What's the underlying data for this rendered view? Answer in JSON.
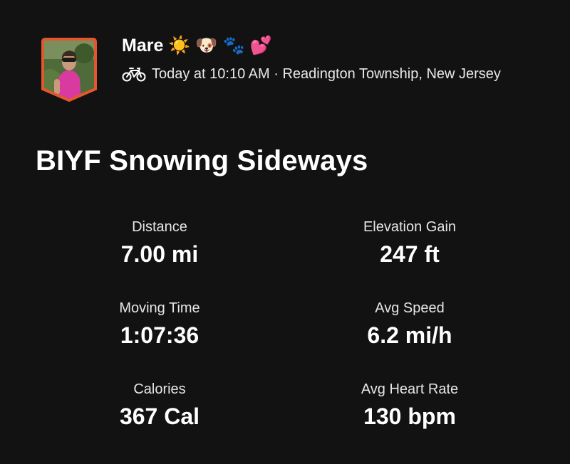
{
  "athlete": {
    "name": "Mare",
    "name_emojis": "☀️ 🐶 🐾 💕",
    "activity_type_icon": "bike-icon",
    "timestamp": "Today at 10:10 AM",
    "separator": " · ",
    "location": "Readington Township, New Jersey"
  },
  "activity": {
    "title": "BIYF Snowing Sideways"
  },
  "stats": [
    {
      "label": "Distance",
      "value": "7.00 mi"
    },
    {
      "label": "Elevation Gain",
      "value": "247 ft"
    },
    {
      "label": "Moving Time",
      "value": "1:07:36"
    },
    {
      "label": "Avg Speed",
      "value": "6.2 mi/h"
    },
    {
      "label": "Calories",
      "value": "367 Cal"
    },
    {
      "label": "Avg Heart Rate",
      "value": "130 bpm"
    }
  ],
  "colors": {
    "background": "#121212",
    "text": "#ffffff",
    "avatar_border": "#e4572e"
  }
}
